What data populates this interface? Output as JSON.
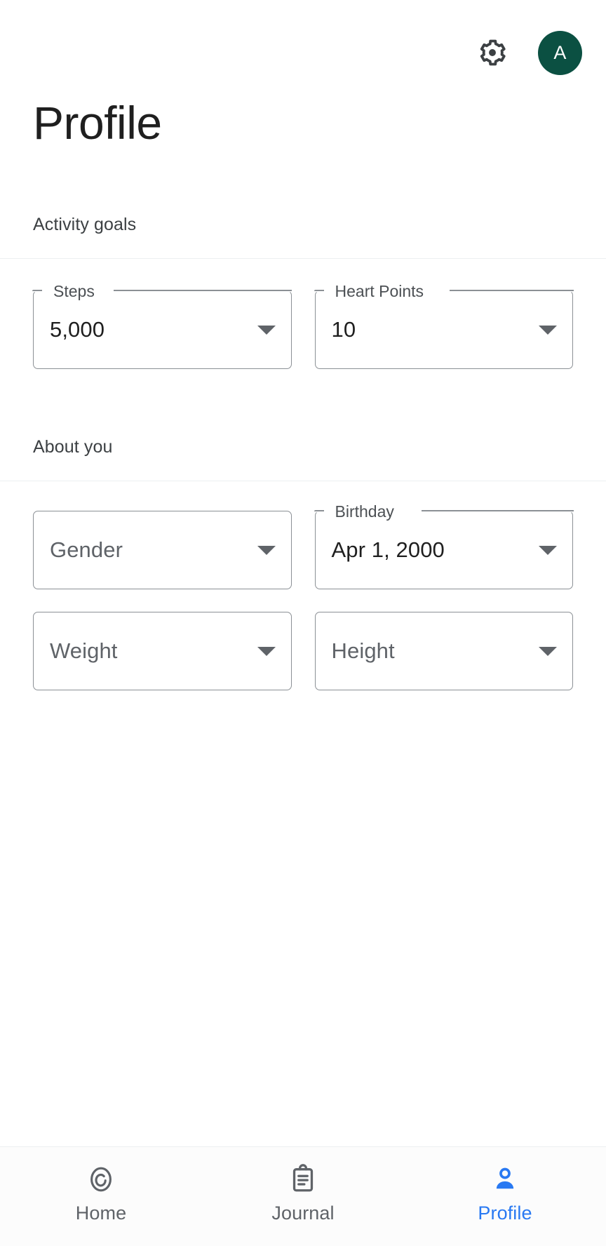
{
  "appbar": {
    "settings_icon": "gear-icon",
    "avatar_initial": "A",
    "avatar_color": "#0b5042"
  },
  "page": {
    "title": "Profile"
  },
  "sections": [
    {
      "id": "activity-goals",
      "header": "Activity goals"
    },
    {
      "id": "about-you",
      "header": "About you"
    }
  ],
  "fields": {
    "steps": {
      "label": "Steps",
      "value": "5,000",
      "has_label": true,
      "is_placeholder": false
    },
    "heart_points": {
      "label": "Heart Points",
      "value": "10",
      "has_label": true,
      "is_placeholder": false
    },
    "gender": {
      "label": "",
      "value": "Gender",
      "has_label": false,
      "is_placeholder": true
    },
    "birthday": {
      "label": "Birthday",
      "value": "Apr 1, 2000",
      "has_label": true,
      "is_placeholder": false
    },
    "weight": {
      "label": "",
      "value": "Weight",
      "has_label": false,
      "is_placeholder": true
    },
    "height": {
      "label": "",
      "value": "Height",
      "has_label": false,
      "is_placeholder": true
    }
  },
  "bottom_nav": {
    "active": "Profile",
    "active_color": "#2979f2",
    "items": [
      {
        "label": "Home",
        "icon": "activity-ring-icon",
        "active": false
      },
      {
        "label": "Journal",
        "icon": "clipboard-icon",
        "active": false
      },
      {
        "label": "Profile",
        "icon": "person-icon",
        "active": true
      }
    ]
  }
}
